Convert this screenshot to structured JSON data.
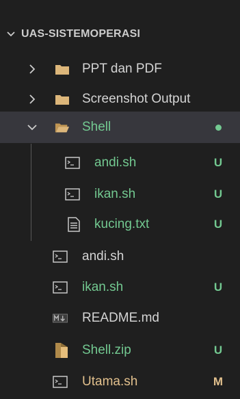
{
  "explorer": {
    "root": {
      "label": "UAS-SISTEMOPERASI",
      "chevron": "chevron-down-icon"
    },
    "items": [
      {
        "name": "PPT dan PDF",
        "type": "folder",
        "expanded": false,
        "status": "",
        "color": "default"
      },
      {
        "name": "Screenshot Output",
        "type": "folder",
        "expanded": false,
        "status": "",
        "color": "default"
      },
      {
        "name": "Shell",
        "type": "folder",
        "expanded": true,
        "status": "●",
        "color": "untracked",
        "selected": true
      },
      {
        "name": "andi.sh",
        "type": "shell-file",
        "depth": 1,
        "status": "U",
        "color": "untracked"
      },
      {
        "name": "ikan.sh",
        "type": "shell-file",
        "depth": 1,
        "status": "U",
        "color": "untracked"
      },
      {
        "name": "kucing.txt",
        "type": "text-file",
        "depth": 1,
        "status": "U",
        "color": "untracked"
      },
      {
        "name": "andi.sh",
        "type": "shell-file",
        "depth": 0,
        "status": "",
        "color": "default"
      },
      {
        "name": "ikan.sh",
        "type": "shell-file",
        "depth": 0,
        "status": "U",
        "color": "untracked"
      },
      {
        "name": "README.md",
        "type": "markdown-file",
        "depth": 0,
        "status": "",
        "color": "default"
      },
      {
        "name": "Shell.zip",
        "type": "zip-file",
        "depth": 0,
        "status": "U",
        "color": "untracked"
      },
      {
        "name": "Utama.sh",
        "type": "shell-file",
        "depth": 0,
        "status": "M",
        "color": "modified"
      }
    ]
  },
  "colors": {
    "background": "#1f1f1f",
    "selected_row": "#37373d",
    "default_text": "#d4d4d4",
    "untracked": "#73c991",
    "modified": "#e2c08d",
    "folder": "#dcb67a"
  }
}
